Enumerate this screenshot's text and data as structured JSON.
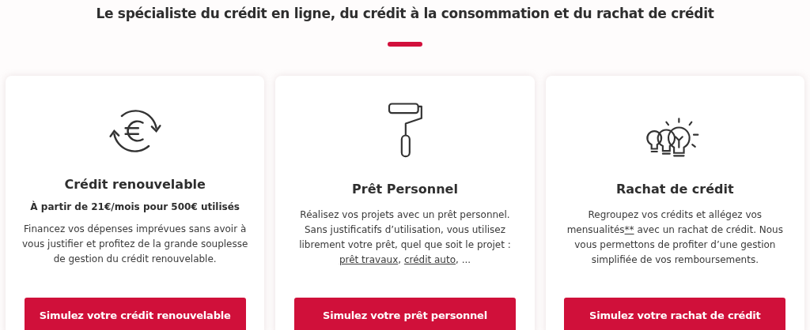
{
  "heading": "Le spécialiste du crédit en ligne, du crédit à la consommation et du rachat de crédit",
  "cards": [
    {
      "title": "Crédit renouvelable",
      "subtitle": "À partir de 21€/mois pour 500€ utilisés",
      "description": [
        {
          "text": "Financez vos dépenses imprévues sans avoir à vous justifier et profitez de la grande souplesse de gestion du crédit renouvelable.",
          "link": false
        }
      ],
      "button": "Simulez votre crédit renouvelable"
    },
    {
      "title": "Prêt Personnel",
      "description": [
        {
          "text": "Réalisez vos projets avec un prêt personnel. Sans justificatifs d’utilisation, vous utilisez librement votre prêt, quel que soit le projet : ",
          "link": false
        },
        {
          "text": "prêt travaux",
          "link": true
        },
        {
          "text": ", ",
          "link": false
        },
        {
          "text": "crédit auto",
          "link": true
        },
        {
          "text": ", ...",
          "link": false
        }
      ],
      "button": "Simulez votre prêt personnel"
    },
    {
      "title": "Rachat de crédit",
      "description": [
        {
          "text": "Regroupez vos crédits et allégez vos mensualités",
          "link": false
        },
        {
          "text": "**",
          "link": true
        },
        {
          "text": " avec un rachat de crédit. Nous vous permettons de profiter d’une gestion simplifiée de vos remboursements.",
          "link": false
        }
      ],
      "button": "Simulez votre rachat de crédit"
    }
  ]
}
